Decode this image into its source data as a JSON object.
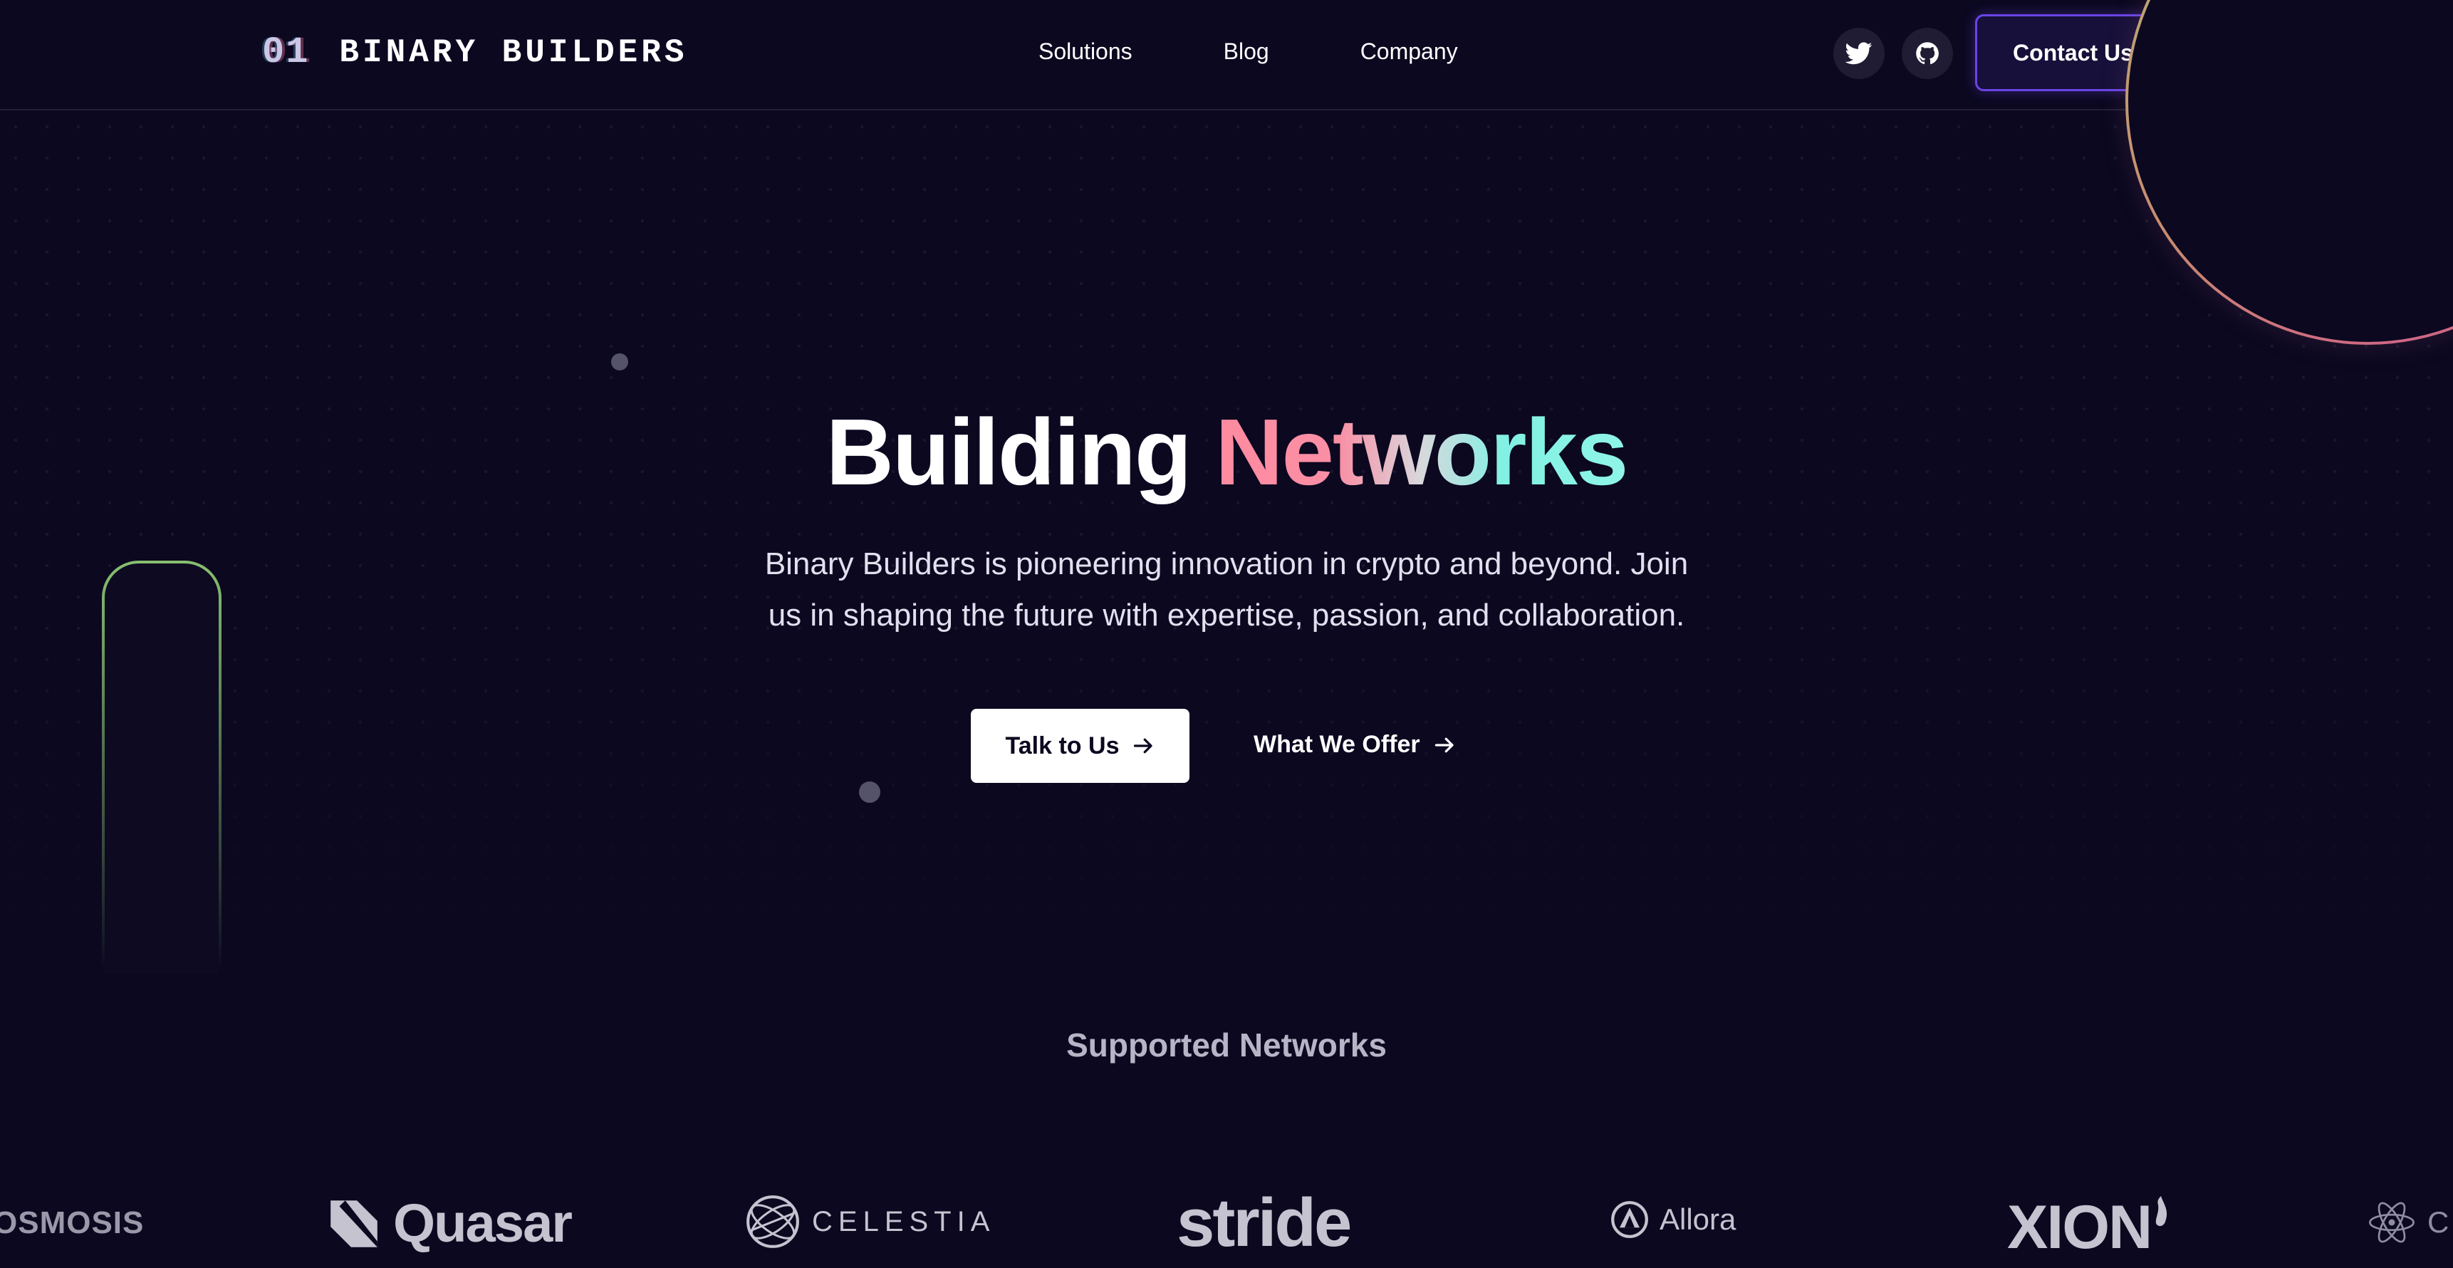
{
  "header": {
    "logo_mark": "01",
    "logo_text": "BINARY BUILDERS",
    "nav": [
      "Solutions",
      "Blog",
      "Company"
    ],
    "contact_label": "Contact Us"
  },
  "hero": {
    "title_plain": "Building",
    "title_accent": "Networks",
    "subtitle_line1": "Binary Builders is pioneering innovation in crypto and beyond. Join",
    "subtitle_line2": "us in shaping the future with expertise, passion, and collaboration.",
    "primary_cta": "Talk to Us",
    "secondary_cta": "What We Offer"
  },
  "networks": {
    "title": "Supported Networks",
    "items": [
      "OSMOSIS",
      "Quasar",
      "CELESTIA",
      "stride",
      "Allora",
      "XION",
      "C"
    ]
  },
  "colors": {
    "background": "#0b0820",
    "accent_purple": "#6a44e6",
    "gradient_pink": "#ff8ba0",
    "gradient_teal": "#8ff5e8"
  },
  "icons": {
    "twitter": "twitter-icon",
    "github": "github-icon",
    "arrow": "arrow-right-icon"
  }
}
